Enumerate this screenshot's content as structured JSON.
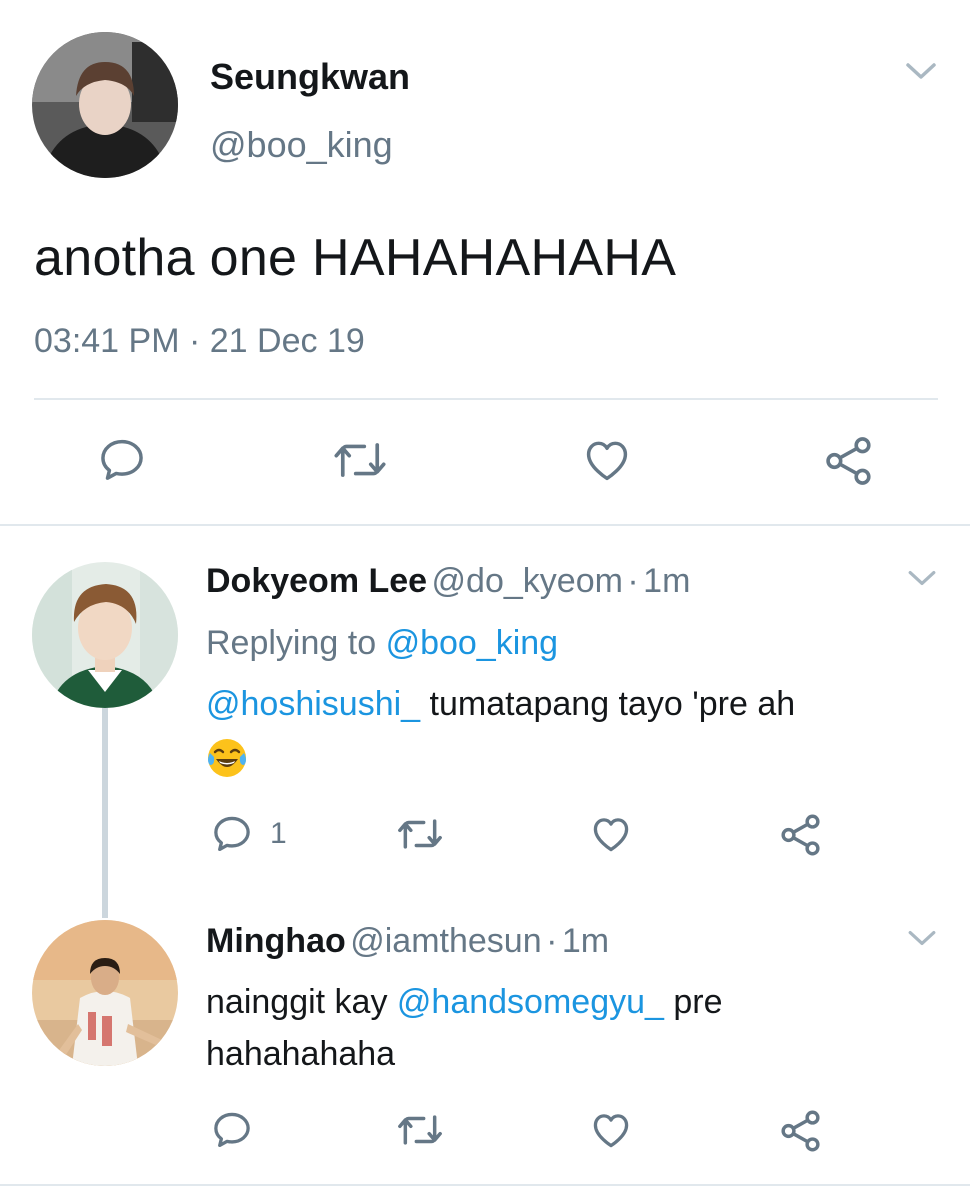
{
  "main_tweet": {
    "display_name": "Seungkwan",
    "handle": "@boo_king",
    "text": "anotha one HAHAHAHAHA",
    "time": "03:41 PM",
    "separator": "·",
    "date": "21 Dec 19",
    "avatar": "person-hoodie-avatar",
    "menu_icon": "chevron-down-icon",
    "actions": [
      "reply-icon",
      "retweet-icon",
      "like-icon",
      "share-icon"
    ]
  },
  "replies": [
    {
      "display_name": "Dokyeom Lee",
      "handle": "@do_kyeom",
      "separator": "·",
      "age": "1m",
      "replying_prefix": "Replying to",
      "replying_to": "@boo_king",
      "mention": "@hoshisushi_",
      "text": " tumatapang tayo 'pre ah",
      "emoji": "face-with-tears-of-joy",
      "reply_count": "1",
      "avatar": "person-portrait-avatar"
    },
    {
      "display_name": "Minghao",
      "handle": "@iamthesun",
      "separator": "·",
      "age": "1m",
      "text_prefix": "nainggit kay ",
      "mention": "@handsomegyu_",
      "text_suffix": " pre",
      "text_line2": "hahahahaha",
      "avatar": "person-sitting-avatar"
    }
  ],
  "colors": {
    "link": "#1b95e0",
    "secondary_text": "#657786",
    "icon": "#657786",
    "divider": "#e1e8ed",
    "thread_line": "#ccd6dd"
  }
}
